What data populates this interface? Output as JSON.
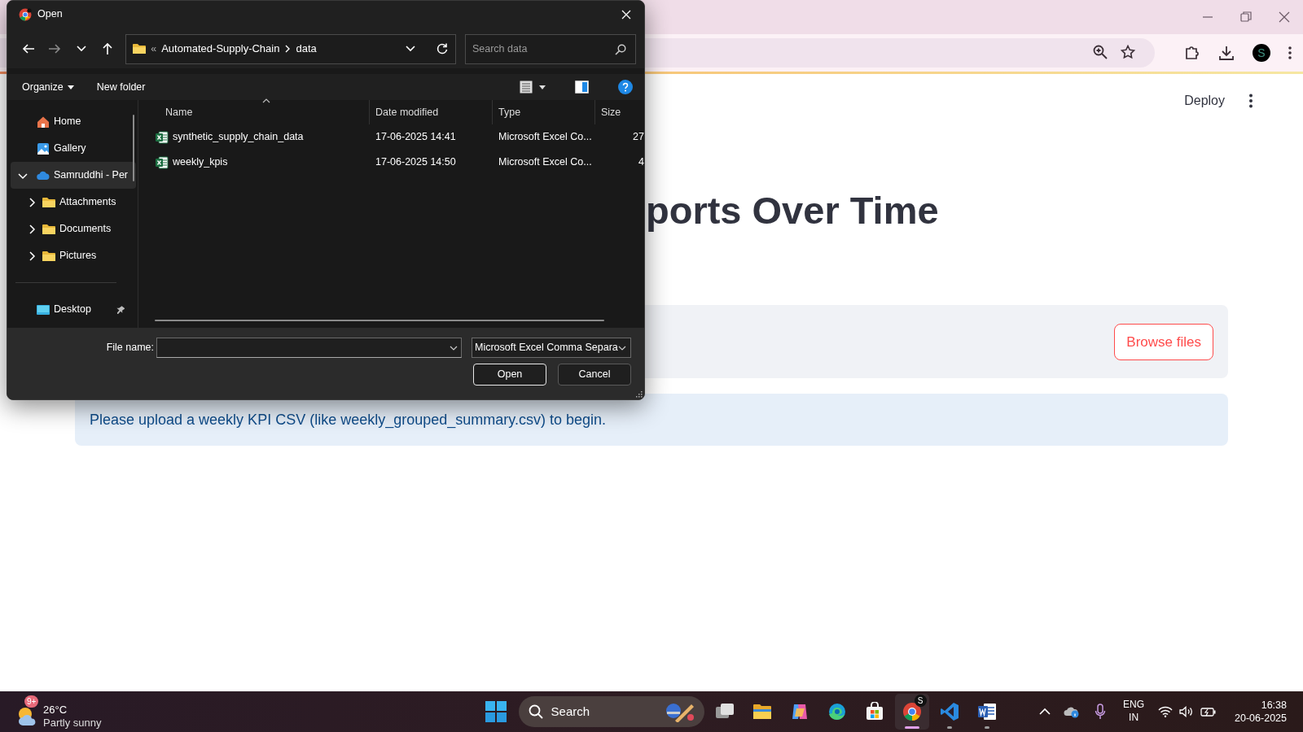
{
  "browser": {
    "profile_letter": "S"
  },
  "page": {
    "deploy": "Deploy",
    "heading": "ports Over Time",
    "uploader": {
      "button": "Browse files"
    },
    "info": "Please upload a weekly KPI CSV (like weekly_grouped_summary.csv) to begin."
  },
  "dialog": {
    "title": "Open",
    "breadcrumb_overflow": "«",
    "breadcrumb": [
      "Automated-Supply-Chain",
      "data"
    ],
    "search": {
      "placeholder": "Search data"
    },
    "commands": [
      {
        "label": "Organize",
        "menu": true
      },
      {
        "label": "New folder",
        "menu": false
      }
    ],
    "nav_items": [
      {
        "label": "Home",
        "kind": "home",
        "selected": false
      },
      {
        "label": "Gallery",
        "kind": "gallery",
        "selected": false
      },
      {
        "label": "Samruddhi - Per",
        "kind": "cloud",
        "selected": true,
        "expanded": true,
        "children": [
          {
            "label": "Attachments",
            "kind": "folder",
            "selected": false,
            "expanded": false
          },
          {
            "label": "Documents",
            "kind": "folder",
            "selected": false,
            "expanded": false
          },
          {
            "label": "Pictures",
            "kind": "folder",
            "selected": false,
            "expanded": false
          }
        ]
      },
      {
        "label": "Desktop",
        "kind": "desktop",
        "selected": false,
        "pinned": true
      }
    ],
    "columns": [
      "Name",
      "Date modified",
      "Type",
      "Size"
    ],
    "files": [
      {
        "name": "synthetic_supply_chain_data",
        "date": "17-06-2025 14:41",
        "type": "Microsoft Excel Co...",
        "size": "27"
      },
      {
        "name": "weekly_kpis",
        "date": "17-06-2025 14:50",
        "type": "Microsoft Excel Co...",
        "size": "4"
      }
    ],
    "file_name_label": "File name:",
    "file_type": "Microsoft Excel Comma Separa",
    "buttons": [
      {
        "label": "Open",
        "default": true
      },
      {
        "label": "Cancel",
        "default": false
      }
    ]
  },
  "taskbar": {
    "weather": {
      "badge": "9+",
      "temperature": "26°C",
      "condition": "Partly sunny"
    },
    "search": "Search",
    "apps": [
      {
        "kind": "taskview",
        "running": false,
        "active": false
      },
      {
        "kind": "explorer",
        "running": false,
        "active": false
      },
      {
        "kind": "copilot",
        "running": false,
        "active": false
      },
      {
        "kind": "edge",
        "running": false,
        "active": false
      },
      {
        "kind": "store",
        "running": false,
        "active": false
      },
      {
        "kind": "chrome",
        "running": true,
        "active": true,
        "badge": "S"
      },
      {
        "kind": "vscode",
        "running": true,
        "active": false
      },
      {
        "kind": "word",
        "running": true,
        "active": false
      }
    ],
    "language": [
      "ENG",
      "IN"
    ],
    "time": "16:38",
    "date": "20-06-2025"
  }
}
